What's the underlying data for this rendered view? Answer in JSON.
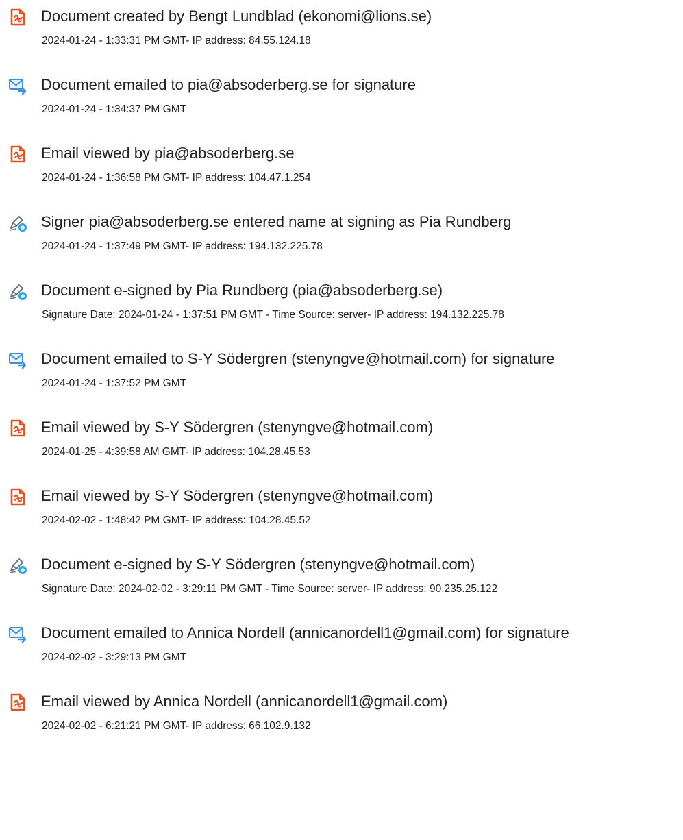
{
  "colors": {
    "document_icon": "#e8501f",
    "email_icon": "#3d8fd6",
    "sign_icon": "#2aa4d9"
  },
  "events": [
    {
      "icon": "document-icon",
      "title": "Document created by Bengt Lundblad (ekonomi@lions.se)",
      "detail": "2024-01-24 - 1:33:31 PM GMT- IP address: 84.55.124.18"
    },
    {
      "icon": "email-icon",
      "title": "Document emailed to pia@absoderberg.se for signature",
      "detail": "2024-01-24 - 1:34:37 PM GMT"
    },
    {
      "icon": "document-icon",
      "title": "Email viewed by pia@absoderberg.se",
      "detail": "2024-01-24 - 1:36:58 PM GMT- IP address: 104.47.1.254"
    },
    {
      "icon": "sign-icon",
      "title": "Signer pia@absoderberg.se entered name at signing as Pia Rundberg",
      "detail": "2024-01-24 - 1:37:49 PM GMT- IP address: 194.132.225.78"
    },
    {
      "icon": "sign-icon",
      "title": "Document e-signed by Pia Rundberg (pia@absoderberg.se)",
      "detail": "Signature Date: 2024-01-24 - 1:37:51 PM GMT - Time Source: server- IP address: 194.132.225.78"
    },
    {
      "icon": "email-icon",
      "title": "Document emailed to S-Y Södergren (stenyngve@hotmail.com) for signature",
      "detail": "2024-01-24 - 1:37:52 PM GMT"
    },
    {
      "icon": "document-icon",
      "title": "Email viewed by S-Y Södergren (stenyngve@hotmail.com)",
      "detail": "2024-01-25 - 4:39:58 AM GMT- IP address: 104.28.45.53"
    },
    {
      "icon": "document-icon",
      "title": "Email viewed by S-Y Södergren (stenyngve@hotmail.com)",
      "detail": "2024-02-02 - 1:48:42 PM GMT- IP address: 104.28.45.52"
    },
    {
      "icon": "sign-icon",
      "title": "Document e-signed by S-Y Södergren (stenyngve@hotmail.com)",
      "detail": "Signature Date: 2024-02-02 - 3:29:11 PM GMT - Time Source: server- IP address: 90.235.25.122"
    },
    {
      "icon": "email-icon",
      "title": "Document emailed to Annica Nordell (annicanordell1@gmail.com) for signature",
      "detail": "2024-02-02 - 3:29:13 PM GMT"
    },
    {
      "icon": "document-icon",
      "title": "Email viewed by Annica Nordell (annicanordell1@gmail.com)",
      "detail": "2024-02-02 - 6:21:21 PM GMT- IP address: 66.102.9.132"
    }
  ]
}
